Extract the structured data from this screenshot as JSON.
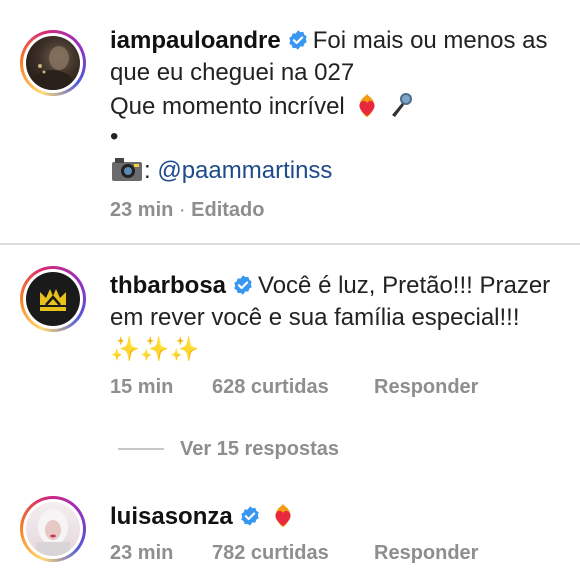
{
  "comments": [
    {
      "username": "iampauloandre",
      "text_line1": "Foi mais ou menos as",
      "text_line2": "que eu cheguei na 027",
      "text_line3": "Que momento incrível",
      "text_line4": "•",
      "photo_credit_prefix": ":",
      "mention": "@paammartinss",
      "time": "23 min",
      "separator": "·",
      "edited": "Editado",
      "emojis": [
        "heart-on-fire",
        "microphone"
      ]
    },
    {
      "username": "thbarbosa",
      "text_line1": "Você é luz, Pretão!!! Prazer",
      "text_line2": "em rever você e sua família especial!!!",
      "text_line3": "✨✨✨",
      "time": "15 min",
      "likes": "628 curtidas",
      "reply": "Responder",
      "view_replies": "Ver 15 respostas"
    },
    {
      "username": "luisasonza",
      "time": "23 min",
      "likes": "782 curtidas",
      "reply": "Responder",
      "emojis": [
        "heart-on-fire"
      ]
    }
  ],
  "colors": {
    "verified_blue": "#3897f0",
    "meta_gray": "#8e8e8e",
    "mention_blue": "#1e4b8c",
    "divider": "#dbdbdb"
  }
}
